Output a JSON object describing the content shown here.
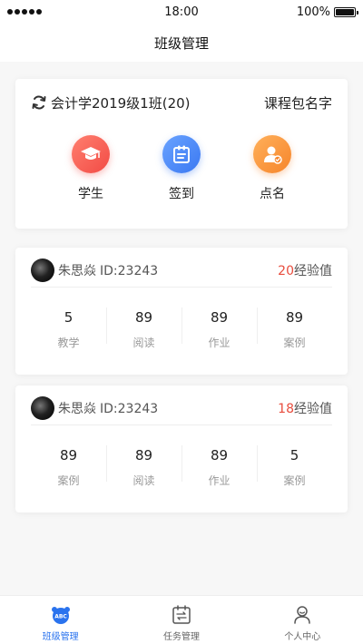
{
  "status_bar": {
    "time": "18:00",
    "battery": "100%"
  },
  "nav": {
    "title": "班级管理"
  },
  "class_card": {
    "class_name": "会计学2019级1班(20)",
    "course_name": "课程包名字",
    "actions": [
      {
        "label": "学生",
        "icon": "graduation-cap-icon",
        "color": "#f24b45"
      },
      {
        "label": "签到",
        "icon": "clipboard-checkin-icon",
        "color": "#3a78f2"
      },
      {
        "label": "点名",
        "icon": "person-check-icon",
        "color": "#f6852b"
      }
    ]
  },
  "students": [
    {
      "name": "朱思焱",
      "id": "ID:23243",
      "exp_value": "20",
      "exp_suffix": "经验值",
      "stats": [
        {
          "value": "5",
          "label": "教学"
        },
        {
          "value": "89",
          "label": "阅读"
        },
        {
          "value": "89",
          "label": "作业"
        },
        {
          "value": "89",
          "label": "案例"
        }
      ]
    },
    {
      "name": "朱思焱",
      "id": "ID:23243",
      "exp_value": "18",
      "exp_suffix": "经验值",
      "stats": [
        {
          "value": "89",
          "label": "案例"
        },
        {
          "value": "89",
          "label": "阅读"
        },
        {
          "value": "89",
          "label": "作业"
        },
        {
          "value": "5",
          "label": "案例"
        }
      ]
    }
  ],
  "tabbar": {
    "items": [
      {
        "label": "班级管理",
        "icon": "class-abc-icon",
        "active": true
      },
      {
        "label": "任务管理",
        "icon": "task-calendar-icon",
        "active": false
      },
      {
        "label": "个人中心",
        "icon": "profile-icon",
        "active": false
      }
    ]
  },
  "colors": {
    "accent": "#2a73ee",
    "exp_number": "#e84c3d"
  }
}
